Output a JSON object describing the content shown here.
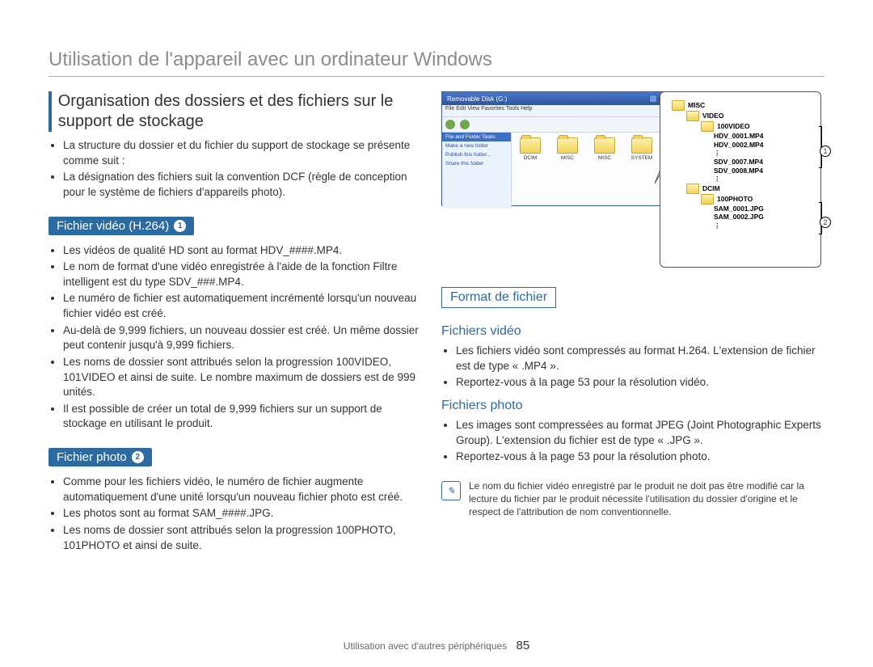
{
  "page": {
    "title": "Utilisation de l'appareil avec un ordinateur Windows",
    "footer_section": "Utilisation avec d'autres périphériques",
    "page_number": "85"
  },
  "left": {
    "section_heading": "Organisation des dossiers et des fichiers sur le support de stockage",
    "intro_bullets": [
      "La structure du dossier et du fichier du support de stockage se présente comme suit :",
      "La désignation des fichiers suit la convention DCF (règle de conception pour le système de fichiers d'appareils photo)."
    ],
    "video": {
      "tag": "Fichier vidéo (H.264)",
      "badge": "1",
      "bullets": [
        "Les vidéos de qualité HD sont au format HDV_####.MP4.",
        "Le nom de format d'une vidéo enregistrée à l'aide de la fonction Filtre intelligent est du type SDV_###.MP4.",
        "Le numéro de fichier est automatiquement incrémenté lorsqu'un nouveau fichier vidéo est créé.",
        "Au-delà de 9,999 fichiers, un nouveau dossier est créé. Un même dossier peut contenir jusqu'à 9,999 fichiers.",
        "Les noms de dossier sont attribués selon la progression 100VIDEO, 101VIDEO et ainsi de suite. Le nombre maximum de dossiers est de 999 unités.",
        "Il est possible de créer un total de 9,999 fichiers sur un support de stockage en utilisant le produit."
      ]
    },
    "photo": {
      "tag": "Fichier photo",
      "badge": "2",
      "bullets": [
        "Comme pour les fichiers vidéo, le numéro de fichier augmente automatiquement d'une unité lorsqu'un nouveau fichier photo est créé.",
        "Les photos sont au format SAM_####.JPG.",
        "Les noms de dossier sont attribués selon la progression 100PHOTO, 101PHOTO et ainsi de suite."
      ]
    }
  },
  "figure": {
    "window_title": "Removable Disk (G:)",
    "menubar": "File   Edit   View   Favorites   Tools   Help",
    "side_hdr": "File and Folder Tasks",
    "side_items": [
      "Make a new folder",
      "Publish this folder...",
      "Share this folder"
    ],
    "folders": [
      "DCIM",
      "MISC",
      "MISC",
      "SYSTEM"
    ],
    "tree": {
      "root_misc": "MISC",
      "video_folder": "VIDEO",
      "video_sub": "100VIDEO",
      "video_files": [
        "HDV_0001.MP4",
        "HDV_0002.MP4",
        "SDV_0007.MP4",
        "SDV_0008.MP4"
      ],
      "dcim_folder": "DCIM",
      "photo_sub": "100PHOTO",
      "photo_files": [
        "SAM_0001.JPG",
        "SAM_0002.JPG"
      ],
      "dots": "⋮"
    },
    "annot1": "1",
    "annot2": "2"
  },
  "right": {
    "format_heading": "Format de fichier",
    "video": {
      "title": "Fichiers vidéo",
      "bullets": [
        "Les fichiers vidéo sont compressés au format H.264. L'extension de fichier est de type « .MP4 ».",
        "Reportez-vous à la page 53 pour la résolution vidéo."
      ]
    },
    "photo": {
      "title": "Fichiers photo",
      "bullets": [
        "Les images sont compressées au format JPEG (Joint Photographic Experts Group). L'extension du fichier est de type « .JPG ».",
        "Reportez-vous à la page 53 pour la résolution photo."
      ]
    },
    "note": "Le nom du fichier vidéo enregistré par le produit ne doit pas être modifié car la lecture du fichier par le produit nécessite l'utilisation du dossier d'origine et le respect de l'attribution de nom conventionnelle."
  }
}
